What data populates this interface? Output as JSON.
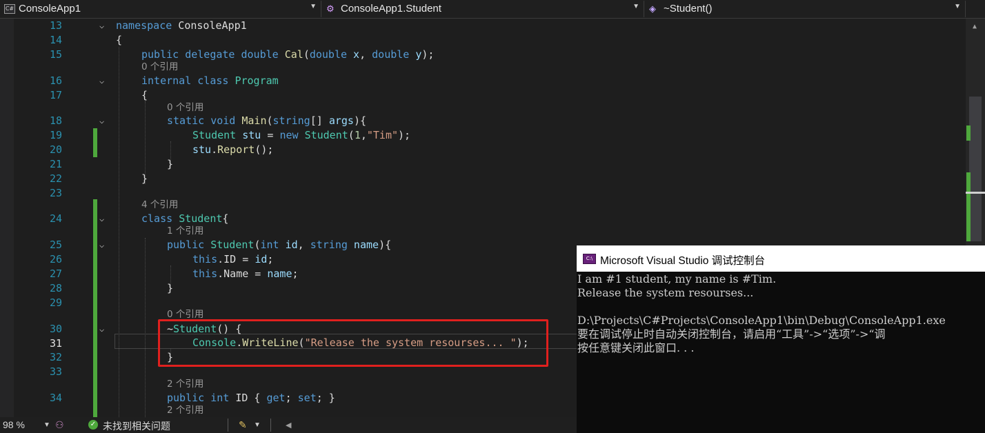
{
  "navbar": {
    "project": "ConsoleApp1",
    "type": "ConsoleApp1.Student",
    "member": "~Student()"
  },
  "editor": {
    "line_numbers": [
      "13",
      "14",
      "15",
      "16",
      "17",
      "18",
      "19",
      "20",
      "21",
      "22",
      "23",
      "24",
      "25",
      "26",
      "27",
      "28",
      "29",
      "30",
      "31",
      "32",
      "33",
      "34"
    ],
    "current_line": "31",
    "references": {
      "cal": "0 个引用",
      "main": "0 个引用",
      "student_class": "4 个引用",
      "student_ctor": "1 个引用",
      "finalizer": "0 个引用",
      "id_prop": "2 个引用",
      "name_prop": "2 个引用"
    },
    "code": {
      "l13_kw": "namespace",
      "l13_name": " ConsoleApp1",
      "l14": "{",
      "l15_kw": "public delegate double ",
      "l15_method": "Cal",
      "l15_p1": "(",
      "l15_t1": "double",
      "l15_n1": " x",
      "l15_c": ", ",
      "l15_t2": "double",
      "l15_n2": " y",
      "l15_end": ");",
      "l16_kw": "internal class ",
      "l16_type": "Program",
      "l17": "{",
      "l18_kw": "static void ",
      "l18_method": "Main",
      "l18_p": "(",
      "l18_t": "string",
      "l18_arr": "[] ",
      "l18_arg": "args",
      "l18_end": "){",
      "l19_type": "Student",
      "l19_var": " stu",
      "l19_eq": " = ",
      "l19_new": "new ",
      "l19_type2": "Student",
      "l19_p": "(",
      "l19_num": "1",
      "l19_c": ",",
      "l19_str": "\"Tim\"",
      "l19_end": ");",
      "l20_var": "stu",
      "l20_dot": ".",
      "l20_method": "Report",
      "l20_end": "();",
      "l21": "}",
      "l22": "}",
      "l24_kw": "class ",
      "l24_type": "Student",
      "l24_end": "{",
      "l25_kw": "public ",
      "l25_type": "Student",
      "l25_p": "(",
      "l25_t1": "int",
      "l25_n1": " id",
      "l25_c": ", ",
      "l25_t2": "string",
      "l25_n2": " name",
      "l25_end": "){",
      "l26_this": "this",
      "l26_mid": ".ID = ",
      "l26_val": "id",
      "l26_end": ";",
      "l27_this": "this",
      "l27_mid": ".Name = ",
      "l27_val": "name",
      "l27_end": ";",
      "l28": "}",
      "l30_tilde": "~",
      "l30_type": "Student",
      "l30_end": "() {",
      "l31_type": "Console",
      "l31_dot": ".",
      "l31_method": "WriteLine",
      "l31_p": "(",
      "l31_str": "\"Release the system resourses... \"",
      "l31_end": ");",
      "l32": "}",
      "l34_kw": "public int ",
      "l34_name": "ID",
      "l34_ob": " { ",
      "l34_get": "get",
      "l34_s1": "; ",
      "l34_set": "set",
      "l34_end": "; }"
    }
  },
  "status": {
    "zoom": "98 %",
    "issues": "未找到相关问题"
  },
  "console": {
    "title": "Microsoft Visual Studio 调试控制台",
    "lines": [
      "I am #1 student, my name is #Tim.",
      "Release the system resourses...",
      "",
      "D:\\Projects\\C#Projects\\ConsoleApp1\\bin\\Debug\\ConsoleApp1.exe",
      "要在调试停止时自动关闭控制台，请启用“工具”->“选项”->“调",
      "按任意键关闭此窗口. . ."
    ]
  },
  "colors": {
    "editor_bg": "#1e1e1e",
    "keyword": "#569cd6",
    "type": "#4ec9b0",
    "method": "#dcdcaa",
    "param": "#9cdcfe",
    "string": "#d69d85",
    "line_number": "#2b91af",
    "change_bar": "#4ea83c",
    "highlight_box": "#e0201e",
    "console_bg": "#0c0c0c"
  }
}
